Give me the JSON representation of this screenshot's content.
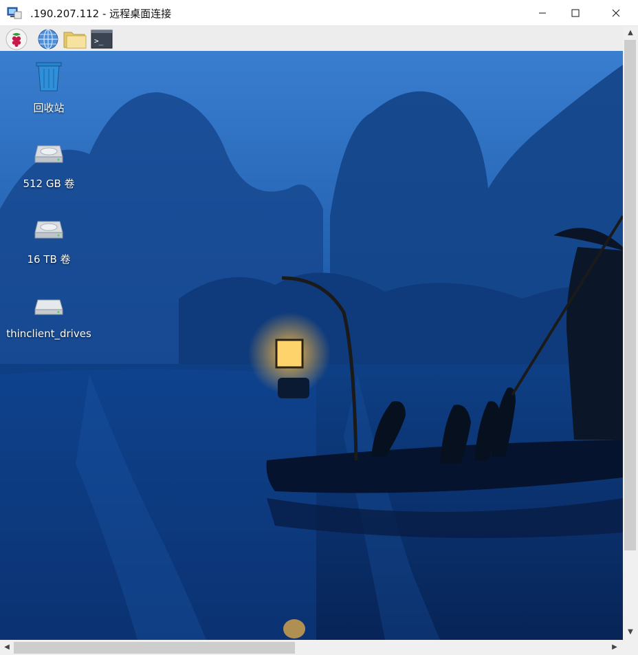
{
  "window": {
    "title": ".190.207.112 - 远程桌面连接",
    "icon": "remote-desktop-icon",
    "controls": {
      "minimize": "minimize-icon",
      "maximize": "maximize-icon",
      "close": "close-icon"
    }
  },
  "toolbar": {
    "items": [
      {
        "name": "raspberry-menu",
        "icon": "raspberry-icon"
      },
      {
        "name": "web-browser",
        "icon": "globe-icon"
      },
      {
        "name": "file-manager",
        "icon": "folder-icon"
      },
      {
        "name": "terminal",
        "icon": "terminal-icon",
        "glyph": ">_"
      }
    ]
  },
  "desktop": {
    "icons": [
      {
        "label": "回收站",
        "icon": "trash-icon"
      },
      {
        "label": "512 GB 卷",
        "icon": "drive-icon"
      },
      {
        "label": "16 TB 卷",
        "icon": "drive-icon"
      },
      {
        "label": "thinclient_drives",
        "icon": "drive-icon"
      }
    ]
  },
  "scrollbars": {
    "up": "▲",
    "down": "▼",
    "left": "◀",
    "right": "▶"
  },
  "colors": {
    "sky": "#2f6fc0",
    "water": "#0a2f6c",
    "mountain": "#123f86",
    "lamp": "#ffd36b"
  }
}
